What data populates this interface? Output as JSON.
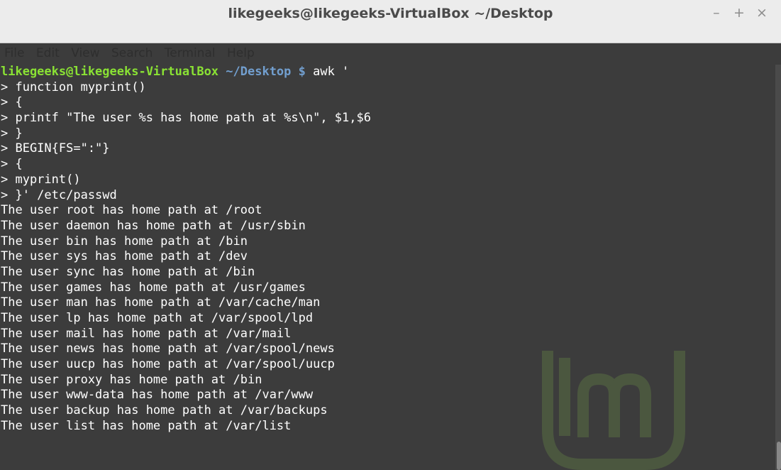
{
  "window": {
    "title": "likegeeks@likegeeks-VirtualBox ~/Desktop",
    "minimize": "–",
    "maximize": "+",
    "close": "×"
  },
  "menu": [
    "File",
    "Edit",
    "View",
    "Search",
    "Terminal",
    "Help"
  ],
  "terminal": {
    "prompt_user": "likegeeks@likegeeks-VirtualBox",
    "prompt_path": " ~/Desktop $",
    "command": " awk '",
    "input_lines": [
      "> function myprint()",
      "> {",
      "> printf \"The user %s has home path at %s\\n\", $1,$6",
      "> }",
      "> BEGIN{FS=\":\"}",
      "> {",
      "> myprint()",
      "> }' /etc/passwd"
    ],
    "output_lines": [
      "The user root has home path at /root",
      "The user daemon has home path at /usr/sbin",
      "The user bin has home path at /bin",
      "The user sys has home path at /dev",
      "The user sync has home path at /bin",
      "The user games has home path at /usr/games",
      "The user man has home path at /var/cache/man",
      "The user lp has home path at /var/spool/lpd",
      "The user mail has home path at /var/mail",
      "The user news has home path at /var/spool/news",
      "The user uucp has home path at /var/spool/uucp",
      "The user proxy has home path at /bin",
      "The user www-data has home path at /var/www",
      "The user backup has home path at /var/backups",
      "The user list has home path at /var/list"
    ]
  },
  "colors": {
    "prompt_user": "#8ae234",
    "prompt_path": "#729fcf",
    "background": "#3c3c3c"
  },
  "icons": [
    "linux-mint-logo"
  ]
}
